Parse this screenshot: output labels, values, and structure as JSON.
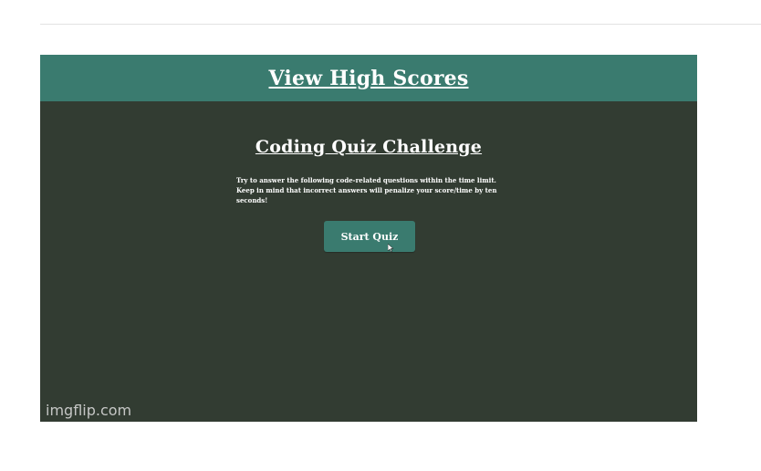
{
  "top_fragment": {
    "text": "▪▪ ▪"
  },
  "gif": {
    "banner": {
      "link_label": "View High Scores"
    },
    "quiz": {
      "title": "Coding Quiz Challenge",
      "description": "Try to answer the following code-related questions within the time limit. Keep in mind that incorrect answers will penalize your score/time by ten seconds!",
      "start_button_label": "Start Quiz"
    },
    "watermark": "imgflip.com"
  },
  "colors": {
    "banner": "#3a7b6f",
    "background": "#323c32",
    "text": "#ffffff"
  },
  "icons": {
    "cursor": "pointer-cursor-icon"
  }
}
